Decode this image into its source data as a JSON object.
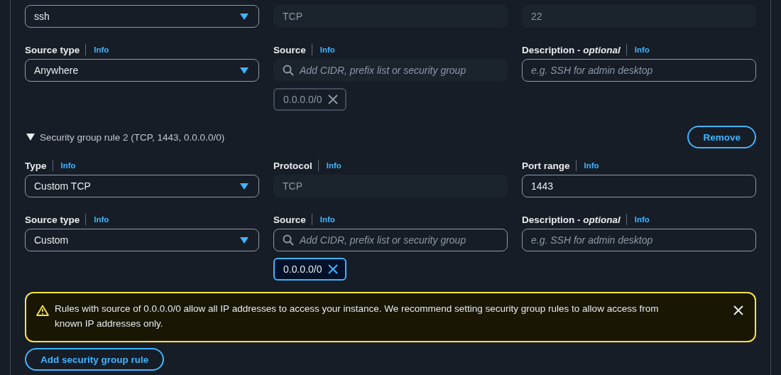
{
  "rules": [
    {
      "rows": [
        {
          "fields": [
            {
              "kind": "select",
              "value": "ssh",
              "disabled": false
            },
            {
              "kind": "text",
              "value": "TCP",
              "disabled": true
            },
            {
              "kind": "text",
              "value": "22",
              "disabled": true
            }
          ]
        },
        {
          "fields": [
            {
              "kind": "select",
              "label": "Source type",
              "info": "Info",
              "value": "Anywhere",
              "disabled": false
            },
            {
              "kind": "search",
              "label": "Source",
              "info": "Info",
              "placeholder": "Add CIDR, prefix list or security group",
              "disabled": true,
              "tokens": [
                {
                  "text": "0.0.0.0/0",
                  "disabled": true
                }
              ]
            },
            {
              "kind": "text",
              "label": "Description - *optional*",
              "info": "Info",
              "placeholder": "e.g. SSH for admin desktop",
              "disabled": false
            }
          ]
        }
      ]
    },
    {
      "title": "Security group rule 2 (TCP, 1443, 0.0.0.0/0)",
      "expanded": true,
      "remove_button": "Remove",
      "rows": [
        {
          "fields": [
            {
              "kind": "select",
              "label": "Type",
              "info": "Info",
              "value": "Custom TCP",
              "disabled": false
            },
            {
              "kind": "text",
              "label": "Protocol",
              "info": "Info",
              "value": "TCP",
              "disabled": true
            },
            {
              "kind": "text",
              "label": "Port range",
              "info": "Info",
              "value": "1443",
              "disabled": false
            }
          ]
        },
        {
          "fields": [
            {
              "kind": "select",
              "label": "Source type",
              "info": "Info",
              "value": "Custom",
              "disabled": false
            },
            {
              "kind": "search",
              "label": "Source",
              "info": "Info",
              "placeholder": "Add CIDR, prefix list or security group",
              "disabled": false,
              "tokens": [
                {
                  "text": "0.0.0.0/0",
                  "disabled": false
                }
              ]
            },
            {
              "kind": "text",
              "label": "Description - *optional*",
              "info": "Info",
              "placeholder": "e.g. SSH for admin desktop",
              "disabled": false
            }
          ]
        }
      ]
    }
  ],
  "warning": {
    "text": "Rules with source of 0.0.0.0/0 allow all IP addresses to access your instance. We recommend setting security group rules to allow access from known IP addresses only."
  },
  "add_button": "Add security group rule"
}
